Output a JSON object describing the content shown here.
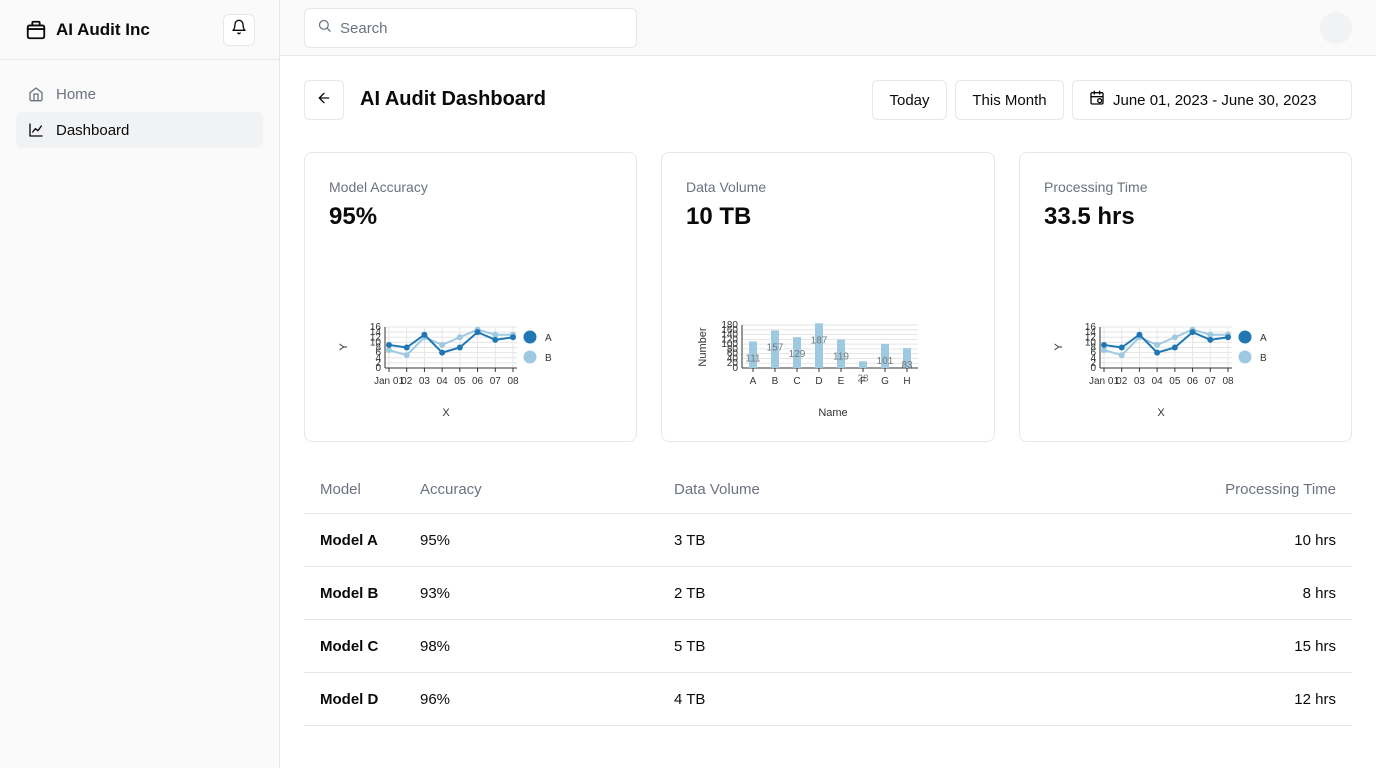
{
  "brand": {
    "name": "AI Audit Inc"
  },
  "nav": {
    "items": [
      {
        "label": "Home"
      },
      {
        "label": "Dashboard"
      }
    ]
  },
  "search": {
    "placeholder": "Search"
  },
  "header": {
    "title": "AI Audit Dashboard",
    "today_label": "Today",
    "month_label": "This Month",
    "date_range": "June 01, 2023 - June 30, 2023"
  },
  "cards": [
    {
      "label": "Model Accuracy",
      "value": "95%"
    },
    {
      "label": "Data Volume",
      "value": "10 TB"
    },
    {
      "label": "Processing Time",
      "value": "33.5 hrs"
    }
  ],
  "table": {
    "headers": {
      "model": "Model",
      "accuracy": "Accuracy",
      "volume": "Data Volume",
      "time": "Processing Time"
    },
    "rows": [
      {
        "model": "Model A",
        "accuracy": "95%",
        "volume": "3 TB",
        "time": "10 hrs"
      },
      {
        "model": "Model B",
        "accuracy": "93%",
        "volume": "2 TB",
        "time": "8 hrs"
      },
      {
        "model": "Model C",
        "accuracy": "98%",
        "volume": "5 TB",
        "time": "15 hrs"
      },
      {
        "model": "Model D",
        "accuracy": "96%",
        "volume": "4 TB",
        "time": "12 hrs"
      }
    ]
  },
  "chart_data": [
    {
      "type": "line",
      "xlabel": "X",
      "ylabel": "Y",
      "x": [
        "Jan 01",
        "02",
        "03",
        "04",
        "05",
        "06",
        "07",
        "08"
      ],
      "ylim": [
        0,
        16
      ],
      "yticks": [
        0,
        2,
        4,
        6,
        8,
        10,
        12,
        14,
        16
      ],
      "legend": "right",
      "series": [
        {
          "name": "A",
          "color": "#1f77b4",
          "values": [
            9,
            8,
            13,
            6,
            8,
            14,
            11,
            12
          ]
        },
        {
          "name": "B",
          "color": "#9ecae1",
          "values": [
            7,
            5,
            12,
            9,
            12,
            15,
            13,
            13
          ]
        }
      ]
    },
    {
      "type": "bar",
      "xlabel": "Name",
      "ylabel": "Number",
      "categories": [
        "A",
        "B",
        "C",
        "D",
        "E",
        "F",
        "G",
        "H"
      ],
      "values": [
        111,
        157,
        129,
        187,
        119,
        28,
        101,
        83
      ],
      "ylim": [
        0,
        180
      ],
      "yticks": [
        0,
        20,
        40,
        60,
        80,
        100,
        120,
        140,
        160,
        180
      ],
      "color": "#9ecae1"
    },
    {
      "type": "line",
      "xlabel": "X",
      "ylabel": "Y",
      "x": [
        "Jan 01",
        "02",
        "03",
        "04",
        "05",
        "06",
        "07",
        "08"
      ],
      "ylim": [
        0,
        16
      ],
      "yticks": [
        0,
        2,
        4,
        6,
        8,
        10,
        12,
        14,
        16
      ],
      "legend": "right",
      "series": [
        {
          "name": "A",
          "color": "#1f77b4",
          "values": [
            9,
            8,
            13,
            6,
            8,
            14,
            11,
            12
          ]
        },
        {
          "name": "B",
          "color": "#9ecae1",
          "values": [
            7,
            5,
            12,
            9,
            12,
            15,
            13,
            13
          ]
        }
      ]
    }
  ]
}
